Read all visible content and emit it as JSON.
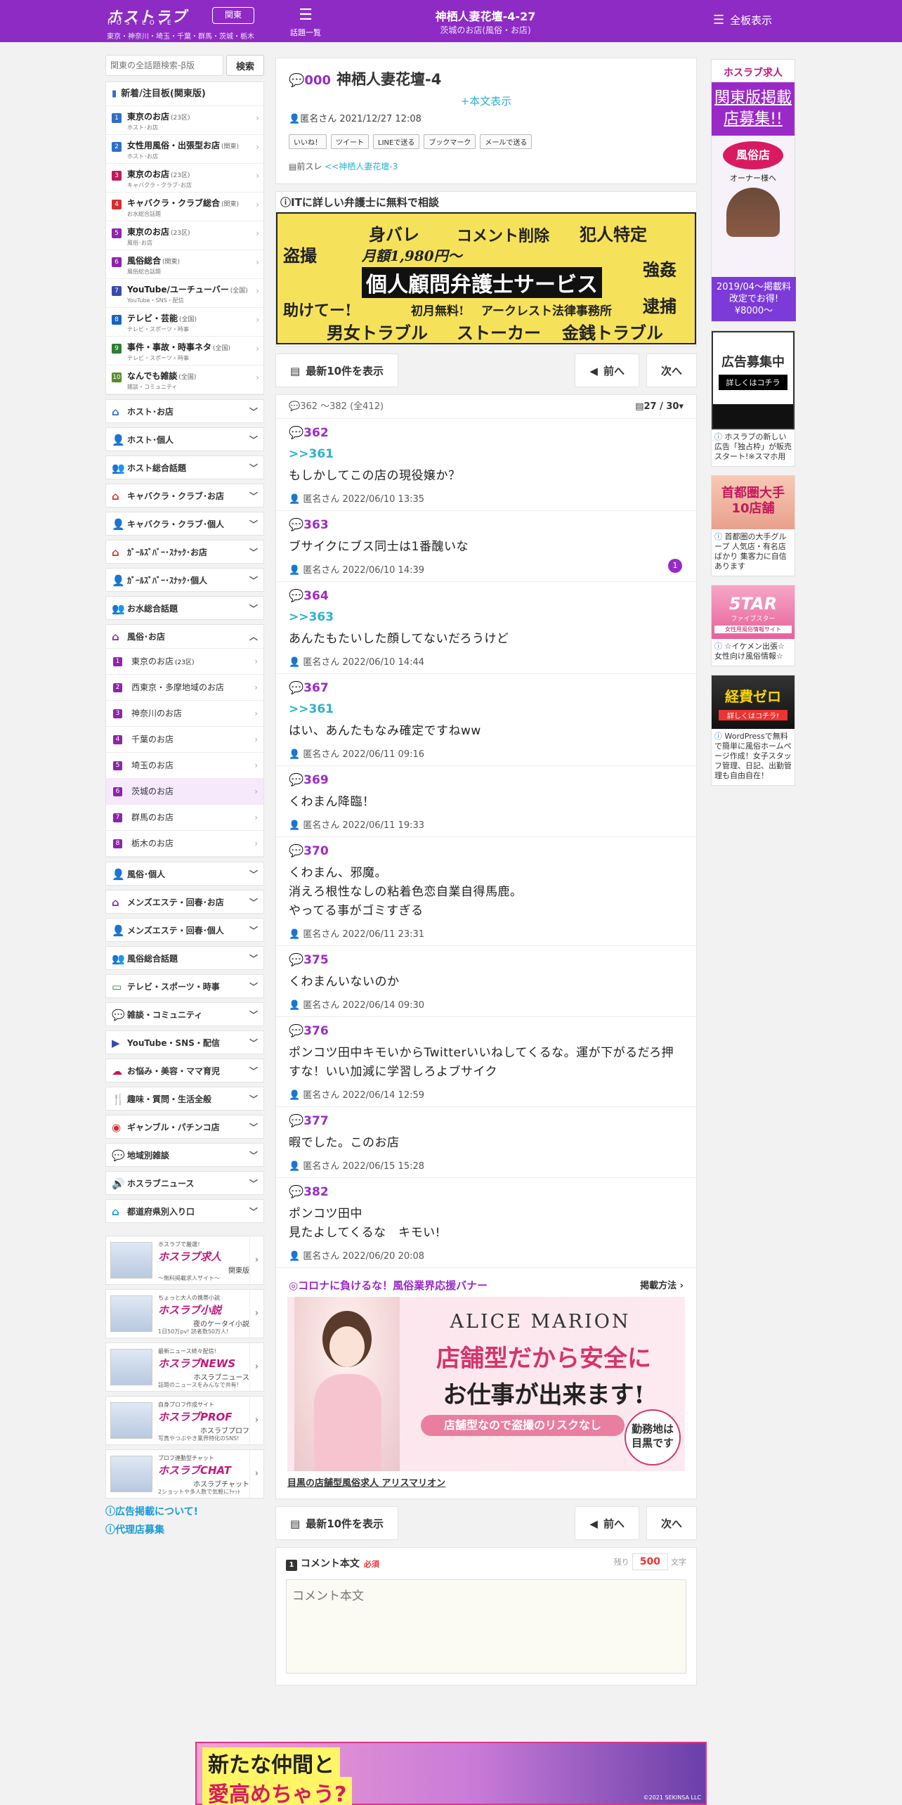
{
  "header": {
    "logo": "ホストラブ",
    "logo_sub": "HOSTLOVE",
    "region_button": "関東",
    "region_line": "東京・神奈川・埼玉・千葉・群馬・茨城・栃木",
    "topic_list": "話題一覧",
    "title": "神栖人妻花壇-4-27",
    "subtitle": "茨城のお店(風俗・お店)",
    "all_boards": "全板表示"
  },
  "sidebar": {
    "search_placeholder": "関東の全話題検索-β版",
    "search_button": "検索",
    "new_header": "新着/注目板(関東版)",
    "new_items": [
      {
        "num": "1",
        "color": "#2e6fc7",
        "title": "東京のお店",
        "count": "(23区)",
        "sub": "ホスト･お店"
      },
      {
        "num": "2",
        "color": "#2e6fc7",
        "title": "女性用風俗・出張型お店",
        "count": "(関東)",
        "sub": "ホスト･お店"
      },
      {
        "num": "3",
        "color": "#c2185b",
        "title": "東京のお店",
        "count": "(23区)",
        "sub": "キャバクラ・クラブ･お店"
      },
      {
        "num": "4",
        "color": "#d32f2f",
        "title": "キャバクラ・クラブ総合",
        "count": "(関東)",
        "sub": "お水総合話題"
      },
      {
        "num": "5",
        "color": "#8e24aa",
        "title": "東京のお店",
        "count": "(23区)",
        "sub": "風俗･お店"
      },
      {
        "num": "6",
        "color": "#8e24aa",
        "title": "風俗総合",
        "count": "(関東)",
        "sub": "風俗総合話題"
      },
      {
        "num": "7",
        "color": "#3949ab",
        "title": "YouTube/ユーチューバー",
        "count": "(全国)",
        "sub": "YouTube・SNS・配信"
      },
      {
        "num": "8",
        "color": "#1565c0",
        "title": "テレビ・芸能",
        "count": "(全国)",
        "sub": "テレビ・スポーツ・時事"
      },
      {
        "num": "9",
        "color": "#2e7d32",
        "title": "事件・事故・時事ネタ",
        "count": "(全国)",
        "sub": "テレビ・スポーツ・時事"
      },
      {
        "num": "10",
        "color": "#558b2f",
        "title": "なんでも雑談",
        "count": "(全国)",
        "sub": "雑談・コミュニティ"
      }
    ],
    "sections_a": [
      {
        "label": "ホスト･お店",
        "icon": "⌂",
        "color": "#2e6fc7"
      },
      {
        "label": "ホスト･個人",
        "icon": "👤",
        "color": "#2e6fc7"
      },
      {
        "label": "ホスト総合話題",
        "icon": "👥",
        "color": "#2e6fc7"
      },
      {
        "label": "キャバクラ・クラブ･お店",
        "icon": "⌂",
        "color": "#d32f2f"
      },
      {
        "label": "キャバクラ・クラブ･個人",
        "icon": "👤",
        "color": "#d32f2f"
      },
      {
        "label": "ｶﾞｰﾙｽﾞﾊﾞｰ･ｽﾅｯｸ･お店",
        "icon": "⌂",
        "color": "#d32f2f"
      },
      {
        "label": "ｶﾞｰﾙｽﾞﾊﾞｰ･ｽﾅｯｸ･個人",
        "icon": "👤",
        "color": "#d32f2f"
      },
      {
        "label": "お水総合話題",
        "icon": "👥",
        "color": "#d32f2f"
      }
    ],
    "open_section": "風俗･お店",
    "sub_items": [
      {
        "num": "1",
        "label": "東京のお店",
        "count": "(23区)"
      },
      {
        "num": "2",
        "label": "西東京・多摩地域のお店",
        "count": ""
      },
      {
        "num": "3",
        "label": "神奈川のお店",
        "count": ""
      },
      {
        "num": "4",
        "label": "千葉のお店",
        "count": ""
      },
      {
        "num": "5",
        "label": "埼玉のお店",
        "count": ""
      },
      {
        "num": "6",
        "label": "茨城のお店",
        "count": ""
      },
      {
        "num": "7",
        "label": "群馬のお店",
        "count": ""
      },
      {
        "num": "8",
        "label": "栃木のお店",
        "count": ""
      }
    ],
    "sections_b": [
      {
        "label": "風俗･個人",
        "icon": "👤",
        "color": "#8e24aa"
      },
      {
        "label": "メンズエステ・回春･お店",
        "icon": "⌂",
        "color": "#8e24aa"
      },
      {
        "label": "メンズエステ・回春･個人",
        "icon": "👤",
        "color": "#8e24aa"
      },
      {
        "label": "風俗総合話題",
        "icon": "👥",
        "color": "#8e24aa"
      },
      {
        "label": "テレビ・スポーツ・時事",
        "icon": "▭",
        "color": "#2e7d32"
      },
      {
        "label": "雑談・コミュニティ",
        "icon": "💬",
        "color": "#2e7d32"
      },
      {
        "label": "YouTube・SNS・配信",
        "icon": "▶",
        "color": "#3949ab"
      },
      {
        "label": "お悩み・美容・ママ育児",
        "icon": "☁",
        "color": "#c2185b"
      },
      {
        "label": "趣味・質問・生活全般",
        "icon": "🍴",
        "color": "#d32f2f"
      },
      {
        "label": "ギャンブル・パチンコ店",
        "icon": "◉",
        "color": "#d32f2f"
      },
      {
        "label": "地域別雑談",
        "icon": "💬",
        "color": "#1a9bd6"
      },
      {
        "label": "ホスラブニュース",
        "icon": "🔊",
        "color": "#333"
      },
      {
        "label": "都道府県別入り口",
        "icon": "⌂",
        "color": "#1a9bd6"
      }
    ],
    "promos": [
      {
        "kicker": "ホスラブで厳選！",
        "brand": "ホスラブ求人",
        "desc": "関東版",
        "desc2": "〜無料掲載求人サイト〜"
      },
      {
        "kicker": "ちょっと大人の携帯小説",
        "brand": "ホスラブ小説",
        "desc": "夜のケータイ小説",
        "desc2": "1日50万pv! 読者数50万人!"
      },
      {
        "kicker": "最新ニュース続々配信!",
        "brand": "ホスラブNEWS",
        "desc": "ホスラブニュース",
        "desc2": "話題のニュースをみんなで共有!"
      },
      {
        "kicker": "自身プロフ作成サイト",
        "brand": "ホスラブPROF",
        "desc": "ホスラブプロフ",
        "desc2": "写真やつぶやき業界特化のSNS!"
      },
      {
        "kicker": "プロフ連動型チャット",
        "brand": "ホスラブCHAT",
        "desc": "ホスラブチャット",
        "desc2": "2ショットや多人数で気軽にﾁｬｯﾄ"
      }
    ],
    "ad_about": "広告掲載について!",
    "agency": "代理店募集"
  },
  "thread": {
    "num": "000",
    "title": "神栖人妻花壇-4",
    "show_body": "+本文表示",
    "author": "匿名さん",
    "date": "2021/12/27 12:08",
    "shares": [
      "いいね！",
      "ツイート",
      "LINEで送る",
      "ブックマーク",
      "メールで送る"
    ],
    "prev_label": "前スレ",
    "prev_link": "<<神栖人妻花壇-3"
  },
  "lawyer_ad": {
    "heading": "ITに詳しい弁護士に無料で相談",
    "words": [
      "身バレ",
      "コメント削除",
      "犯人特定",
      "盗撮",
      "月額1,980円〜",
      "強姦",
      "個人顧問弁護士サービス",
      "助けてー!",
      "初月無料!",
      "アークレスト法律事務所",
      "逮捕",
      "男女トラブル",
      "ストーカー",
      "金銭トラブル"
    ]
  },
  "nav": {
    "latest": "最新10件を表示",
    "prev": "前へ",
    "next": "次へ"
  },
  "posts_head": {
    "range": "362 ～382",
    "total": "(全412)",
    "page": "27 / 30"
  },
  "posts": [
    {
      "no": "362",
      "ref": ">>361",
      "body": "もしかしてこの店の現役嬢か？",
      "author": "匿名さん",
      "date": "2022/06/10 13:35",
      "badge": ""
    },
    {
      "no": "363",
      "ref": "",
      "body": "ブサイクにブス同士は1番醜いな",
      "author": "匿名さん",
      "date": "2022/06/10 14:39",
      "badge": "1"
    },
    {
      "no": "364",
      "ref": ">>363",
      "body": "あんたもたいした顔してないだろうけど",
      "author": "匿名さん",
      "date": "2022/06/10 14:44",
      "badge": ""
    },
    {
      "no": "367",
      "ref": ">>361",
      "body": "はい、あんたもなみ確定ですねww",
      "author": "匿名さん",
      "date": "2022/06/11 09:16",
      "badge": ""
    },
    {
      "no": "369",
      "ref": "",
      "body": "くわまん降臨！",
      "author": "匿名さん",
      "date": "2022/06/11 19:33",
      "badge": ""
    },
    {
      "no": "370",
      "ref": "",
      "body": "くわまん、邪魔。\n消えろ根性なしの粘着色恋自業自得馬鹿。\nやってる事がゴミすぎる",
      "author": "匿名さん",
      "date": "2022/06/11 23:31",
      "badge": ""
    },
    {
      "no": "375",
      "ref": "",
      "body": "くわまんいないのか",
      "author": "匿名さん",
      "date": "2022/06/14 09:30",
      "badge": ""
    },
    {
      "no": "376",
      "ref": "",
      "body": "ポンコツ田中キモいからTwitterいいねしてくるな。運が下がるだろ押すな！いい加減に学習しろよブサイク",
      "author": "匿名さん",
      "date": "2022/06/14 12:59",
      "badge": ""
    },
    {
      "no": "377",
      "ref": "",
      "body": "暇でした。このお店",
      "author": "匿名さん",
      "date": "2022/06/15 15:28",
      "badge": ""
    },
    {
      "no": "382",
      "ref": "",
      "body": "ポンコツ田中\n見たよしてくるな　キモい!",
      "author": "匿名さん",
      "date": "2022/06/20 20:08",
      "badge": ""
    }
  ],
  "banner": {
    "heading": "◎コロナに負けるな！風俗業界応援バナー",
    "how": "掲載方法",
    "brand": "ALICE MARION",
    "line1": "店舗型だから安全に",
    "line2": "お仕事が出来ます!",
    "line3": "店舗型なので盗撮のリスクなし",
    "stamp": "勤務地は目黒です",
    "caption": "目黒の店舗型風俗求人 アリスマリオン"
  },
  "comment": {
    "step": "1",
    "label": "コメント本文",
    "required": "必須",
    "remain_label": "残り",
    "remain": "500",
    "unit": "文字",
    "placeholder": "コメント本文"
  },
  "right_ads": [
    {
      "title": "ホスラブ求人",
      "lines": "関東版掲載店募集!!",
      "badge": "風俗店",
      "sub": "オーナー様へ",
      "foot": "2019/04〜掲載料改定でお得!¥8000〜",
      "caption": ""
    },
    {
      "title": "広告募集中",
      "lines": "詳しくはコチラ",
      "badge": "",
      "sub": "",
      "foot": "",
      "caption": "ホスラブの新しい広告「独占枠」が販売スタート!※スマホ用"
    },
    {
      "title": "首都圏大手10店舗",
      "lines": "",
      "badge": "",
      "sub": "",
      "foot": "",
      "caption": "首都圏の大手グループ 人気店・有名店ばかり 集客力に自信あります"
    },
    {
      "title": "5TAR",
      "lines": "ファイブスター",
      "badge": "",
      "sub": "女性用風俗情報サイト",
      "foot": "",
      "caption": "☆イケメン出張☆女性向け風俗情報☆"
    },
    {
      "title": "経費ゼロ",
      "lines": "詳しくはコチラ!",
      "badge": "",
      "sub": "",
      "foot": "",
      "caption": "WordPressで無料で簡単に風俗ホームページ作成！女子スタッフ管理、日記、出勤管理も自由自在！"
    }
  ],
  "bottom_ad": {
    "line1": "新たな仲間と",
    "line2": "愛高めちゃう?",
    "credit": "©2021 SEKINSA LLC"
  }
}
